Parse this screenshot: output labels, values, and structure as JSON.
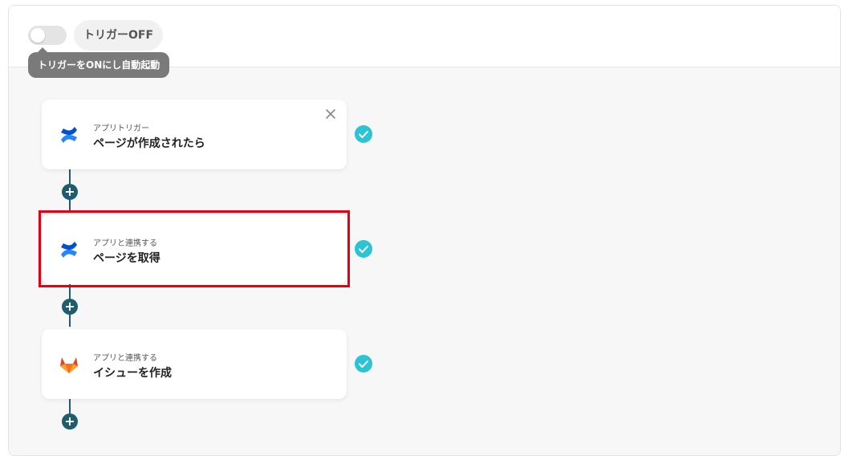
{
  "header": {
    "toggle_state": "off",
    "trigger_label": "トリガーOFF",
    "tooltip": "トリガーをONにし自動起動"
  },
  "flow": {
    "steps": [
      {
        "kind": "アプリトリガー",
        "title": "ページが作成されたら",
        "app_icon": "confluence-icon",
        "status": "complete",
        "highlighted": false
      },
      {
        "kind": "アプリと連携する",
        "title": "ページを取得",
        "app_icon": "confluence-icon",
        "status": "complete",
        "highlighted": true
      },
      {
        "kind": "アプリと連携する",
        "title": "イシューを作成",
        "app_icon": "gitlab-icon",
        "status": "complete",
        "highlighted": false
      }
    ],
    "add_step_symbol": "+"
  },
  "colors": {
    "check": "#2cc3d4",
    "connector": "#1f5c6e",
    "highlight": "#e60012",
    "confluence": "#2684ff",
    "gitlab": "#e24329"
  }
}
